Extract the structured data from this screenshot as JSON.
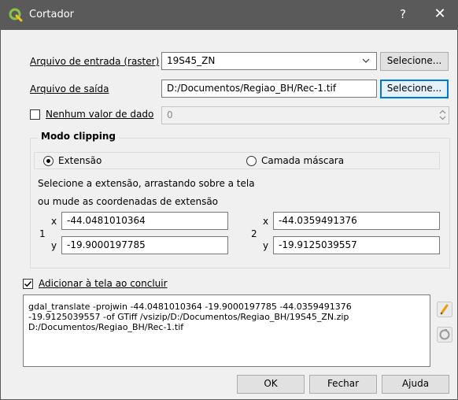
{
  "window": {
    "title": "Cortador",
    "help_label": "?",
    "close_label": "✕",
    "icon": "qgis-logo-icon"
  },
  "input": {
    "label": "Arquivo de entrada (raster)",
    "value": "19S45_ZN",
    "button_label": "Selecione..."
  },
  "output": {
    "label": "Arquivo de saída",
    "value": "D:/Documentos/Regiao_BH/Rec-1.tif",
    "button_label": "Selecione..."
  },
  "nodata": {
    "label": "Nenhum valor de dado",
    "checked": false,
    "value": "0"
  },
  "clipping": {
    "title": "Modo clipping",
    "options": [
      {
        "label": "Extensão",
        "selected": true
      },
      {
        "label": "Camada máscara",
        "selected": false
      }
    ],
    "hint_line1": "Selecione a extensão, arrastando sobre a tela",
    "hint_line2": "ou mude as coordenadas de extensão",
    "point1": {
      "number": "1",
      "x_label": "x",
      "x": "-44.0481010364",
      "y_label": "y",
      "y": "-19.9000197785"
    },
    "point2": {
      "number": "2",
      "x_label": "x",
      "x": "-44.0359491376",
      "y_label": "y",
      "y": "-19.9125039557"
    }
  },
  "add_to_canvas": {
    "label": "Adicionar à tela ao concluir",
    "checked": true
  },
  "command": {
    "lines": [
      "gdal_translate -projwin -44.0481010364 -19.9000197785 -44.0359491376",
      "-19.9125039557 -of GTiff /vsizip/D:/Documentos/Regiao_BH/19S45_ZN.zip",
      "D:/Documentos/Regiao_BH/Rec-1.tif"
    ],
    "edit_icon": "pencil-icon",
    "reset_icon": "reset-icon"
  },
  "buttons": {
    "ok": "OK",
    "close": "Fechar",
    "help": "Ajuda"
  },
  "colors": {
    "titlebar": "#5a5a5a",
    "focus": "#0078d7",
    "qgis_green": "#8bc34a",
    "qgis_yellow": "#f5c518"
  }
}
